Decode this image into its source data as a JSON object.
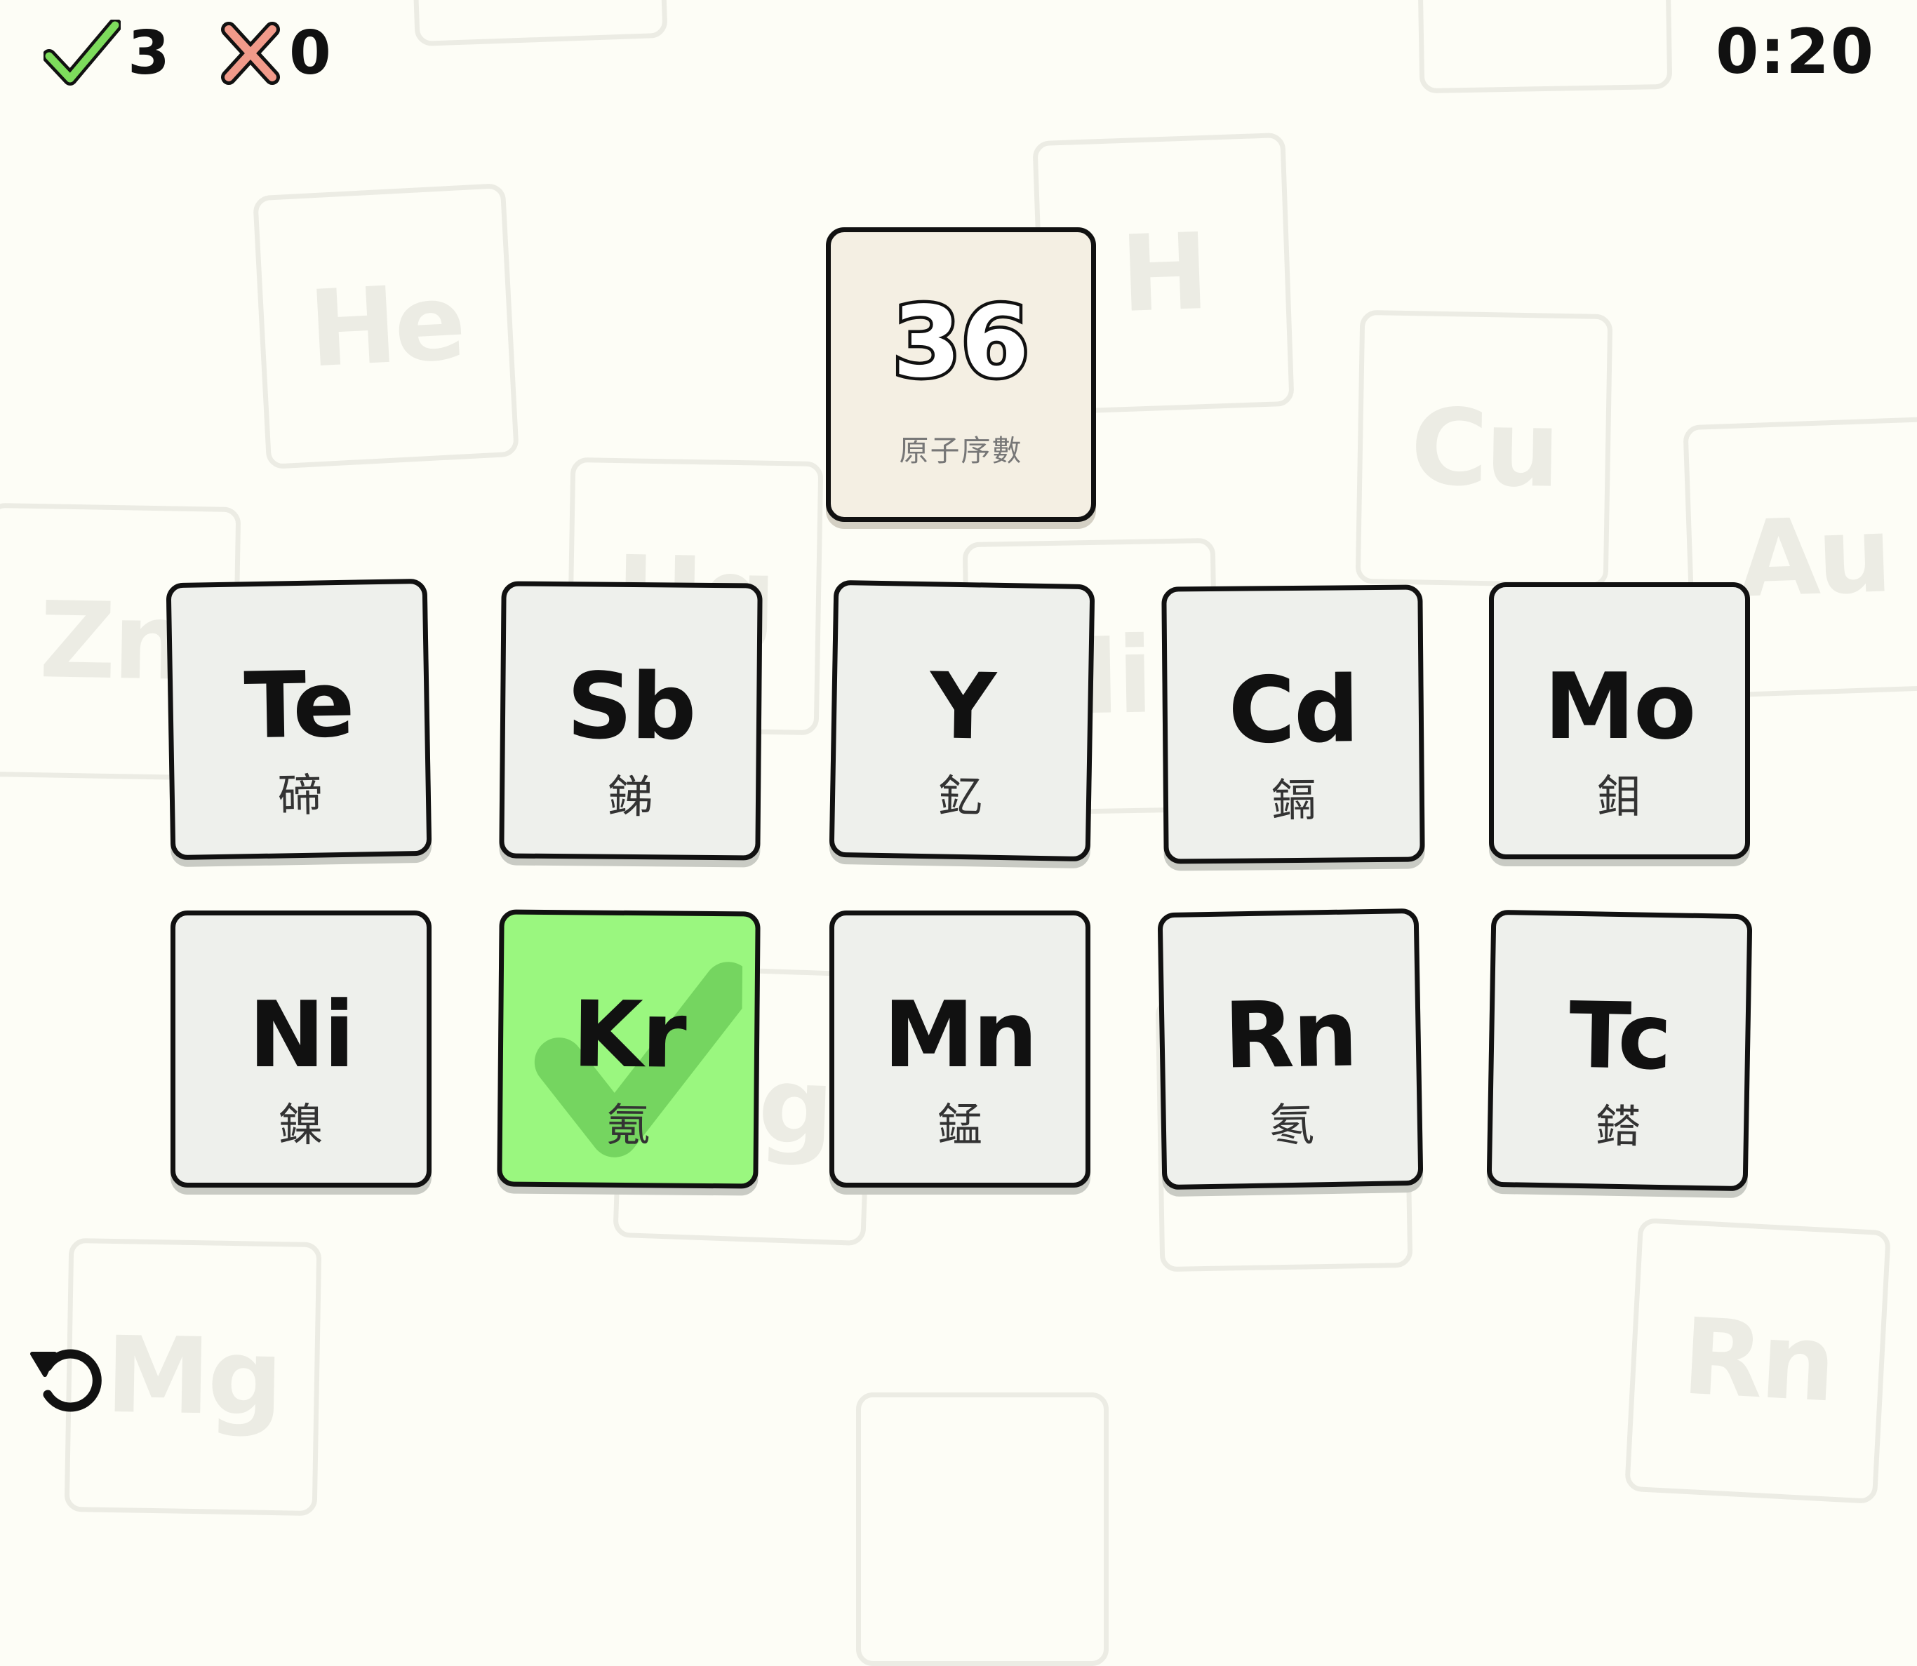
{
  "hud": {
    "correct_count": "3",
    "wrong_count": "0",
    "timer": "0:20"
  },
  "prompt": {
    "value": "36",
    "label": "原子序數"
  },
  "background_symbols": [
    "He",
    "H",
    "Cu",
    "Au",
    "Zn",
    "Hg",
    "Ni",
    "Mg",
    "Rn",
    "Mg"
  ],
  "tiles": [
    {
      "symbol": "Te",
      "name": "碲",
      "state": "normal"
    },
    {
      "symbol": "Sb",
      "name": "銻",
      "state": "normal"
    },
    {
      "symbol": "Y",
      "name": "釔",
      "state": "normal"
    },
    {
      "symbol": "Cd",
      "name": "鎘",
      "state": "normal"
    },
    {
      "symbol": "Mo",
      "name": "鉬",
      "state": "normal"
    },
    {
      "symbol": "Ni",
      "name": "鎳",
      "state": "normal"
    },
    {
      "symbol": "Kr",
      "name": "氪",
      "state": "correct"
    },
    {
      "symbol": "Mn",
      "name": "錳",
      "state": "normal"
    },
    {
      "symbol": "Rn",
      "name": "氡",
      "state": "normal"
    },
    {
      "symbol": "Tc",
      "name": "鎝",
      "state": "normal"
    }
  ],
  "icons": {
    "correct": "check-icon",
    "wrong": "cross-icon",
    "restart": "restart-icon"
  },
  "colors": {
    "background": "#fdfdf6",
    "tile": "#eef0ec",
    "tile_correct": "#9af77f",
    "prompt_card": "#f4efe3",
    "check_green": "#7ddc5c",
    "cross_red": "#f19a8a"
  }
}
